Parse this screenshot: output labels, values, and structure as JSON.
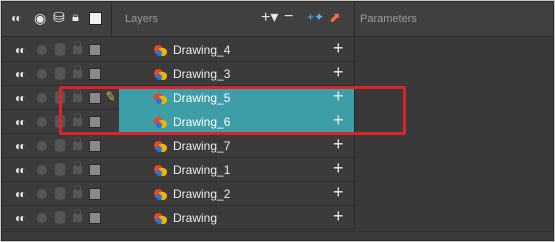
{
  "header": {
    "layers_label": "Layers",
    "parameters_label": "Parameters",
    "icons": [
      "eye-all-icon",
      "dot-icon",
      "database-icon",
      "lock-icon",
      "color-swatch-icon",
      "add-layer-icon",
      "remove-layer-icon",
      "add-peg-icon",
      "add-effect-icon"
    ]
  },
  "selection_color": "#3d9ea7",
  "highlight_color": "#d8242a",
  "layers": [
    {
      "name": "Drawing_4",
      "selected": false,
      "editing": false
    },
    {
      "name": "Drawing_3",
      "selected": false,
      "editing": false
    },
    {
      "name": "Drawing_5",
      "selected": true,
      "editing": true
    },
    {
      "name": "Drawing_6",
      "selected": true,
      "editing": false
    },
    {
      "name": "Drawing_7",
      "selected": false,
      "editing": false
    },
    {
      "name": "Drawing_1",
      "selected": false,
      "editing": false
    },
    {
      "name": "Drawing_2",
      "selected": false,
      "editing": false
    },
    {
      "name": "Drawing",
      "selected": false,
      "editing": false
    }
  ]
}
